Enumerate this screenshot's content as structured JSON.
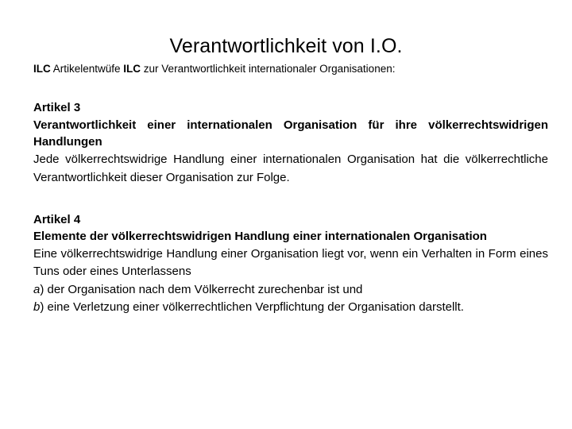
{
  "slide": {
    "title": "Verantwortlichkeit von I.O.",
    "subtitle": {
      "lead_bold": "ILC",
      "middle": " Artikelentwüfe ",
      "second_bold": "ILC",
      "tail": " zur Verantwortlichkeit internationaler Organisationen:"
    },
    "articles": [
      {
        "heading": "Artikel 3",
        "rubric": "Verantwortlichkeit einer internationalen Organisation für ihre völkerrechtswidrigen Handlungen",
        "paragraphs": [
          "Jede völkerrechtswidrige Handlung einer internationalen Organisation hat die völkerrechtliche Verantwortlichkeit dieser Organisation zur Folge."
        ],
        "items": []
      },
      {
        "heading": "Artikel 4",
        "rubric": "Elemente der völkerrechtswidrigen Handlung einer internationalen Organisation",
        "paragraphs": [
          "Eine völkerrechtswidrige Handlung einer Organisation liegt vor, wenn ein Verhalten in Form eines Tuns oder eines Unterlassens"
        ],
        "items": [
          {
            "marker": "a",
            "marker_suffix": ")",
            "text": " der Organisation nach dem Völkerrecht zurechenbar ist und"
          },
          {
            "marker": "b",
            "marker_suffix": ")",
            "text": " eine Verletzung einer völkerrechtlichen Verpflichtung der Organisation darstellt."
          }
        ]
      }
    ]
  },
  "colors": {
    "background": "#ffffff",
    "text": "#000000"
  }
}
